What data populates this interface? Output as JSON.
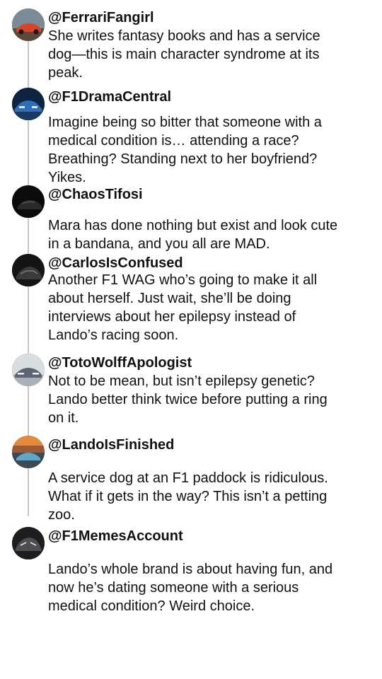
{
  "posts": [
    {
      "username": "@FerrariFangirl",
      "avatar_icon": "red-car-avatar-icon",
      "lines": [
        "She writes fantasy books and has a service",
        "dog—this is main character syndrome at its",
        "peak."
      ]
    },
    {
      "username": "@F1DramaCentral",
      "avatar_icon": "blue-car-avatar-icon",
      "lines": [
        "Imagine being so bitter that someone with a",
        "medical condition is… attending a race?",
        "Breathing? Standing next to her boyfriend?",
        "Yikes."
      ]
    },
    {
      "username": "@ChaosTifosi",
      "avatar_icon": "black-car-avatar-icon",
      "lines": [
        "Mara has done nothing but exist and look cute",
        "in a bandana, and you all are MAD."
      ]
    },
    {
      "username": "@CarlosIsConfused",
      "avatar_icon": "dark-car-avatar-icon",
      "lines": [
        "Another F1 WAG who’s going to make it all",
        "about herself. Just wait, she’ll be doing",
        "interviews about her epilepsy instead of",
        "Lando’s racing soon."
      ]
    },
    {
      "username": "@TotoWolffApologist",
      "avatar_icon": "silver-car-avatar-icon",
      "lines": [
        "Not to be mean, but isn’t epilepsy genetic?",
        "Lando better think twice before putting a ring",
        "on it."
      ]
    },
    {
      "username": "@LandoIsFinished",
      "avatar_icon": "sunset-car-avatar-icon",
      "lines": [
        "A service dog at an F1 paddock is ridiculous.",
        "What if it gets in the way? This isn’t a petting",
        "zoo."
      ]
    },
    {
      "username": "@F1MemesAccount",
      "avatar_icon": "gray-car-avatar-icon",
      "lines": [
        "Lando’s whole brand is about having fun, and",
        "now he’s dating someone with a serious",
        "medical condition? Weird choice."
      ]
    }
  ]
}
